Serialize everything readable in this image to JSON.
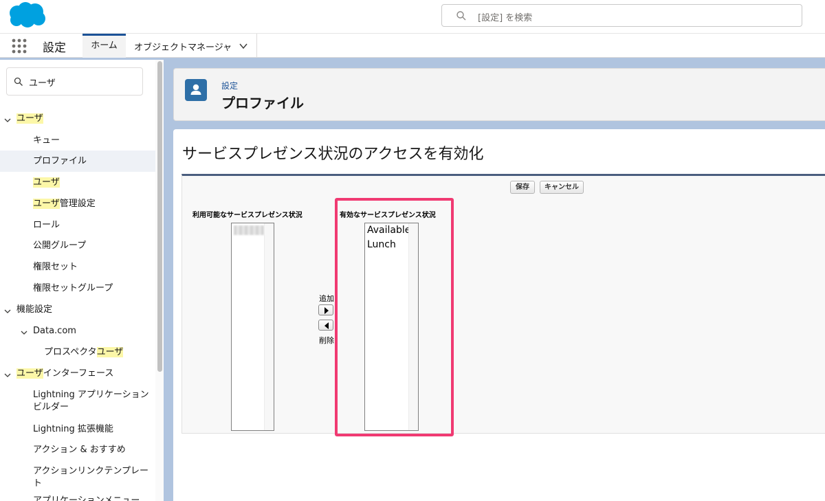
{
  "header": {
    "search_placeholder": "[設定] を検索",
    "brand_color": "#00a1e0"
  },
  "context_bar": {
    "app_name": "設定",
    "tabs": [
      {
        "label": "ホーム",
        "active": true
      },
      {
        "label": "オブジェクトマネージャ",
        "active": false
      }
    ]
  },
  "sidebar": {
    "quickfind_value": "ユーザ",
    "items": [
      {
        "pre": "",
        "hl": "ユーザ",
        "post": "",
        "level": 0,
        "expanded": true
      },
      {
        "pre": "キュー",
        "hl": "",
        "post": "",
        "level": 1
      },
      {
        "pre": "プロファイル",
        "hl": "",
        "post": "",
        "level": 1,
        "selected": true
      },
      {
        "pre": "",
        "hl": "ユーザ",
        "post": "",
        "level": 1
      },
      {
        "pre": "",
        "hl": "ユーザ",
        "post": "管理設定",
        "level": 1
      },
      {
        "pre": "ロール",
        "hl": "",
        "post": "",
        "level": 1
      },
      {
        "pre": "公開グループ",
        "hl": "",
        "post": "",
        "level": 1
      },
      {
        "pre": "権限セット",
        "hl": "",
        "post": "",
        "level": 1
      },
      {
        "pre": "権限セットグループ",
        "hl": "",
        "post": "",
        "level": 1
      },
      {
        "pre": "機能設定",
        "hl": "",
        "post": "",
        "level": 0,
        "expanded": true
      },
      {
        "pre": "Data.com",
        "hl": "",
        "post": "",
        "level": 1,
        "expanded": true
      },
      {
        "pre": "プロスペクタ",
        "hl": "ユーザ",
        "post": "",
        "level": 2
      },
      {
        "pre": "",
        "hl": "ユーザ",
        "post": "インターフェース",
        "level": 0,
        "expanded": true
      },
      {
        "pre": "Lightning アプリケーションビルダー",
        "hl": "",
        "post": "",
        "level": 1
      },
      {
        "pre": "Lightning 拡張機能",
        "hl": "",
        "post": "",
        "level": 1
      },
      {
        "pre": "アクション & おすすめ",
        "hl": "",
        "post": "",
        "level": 1
      },
      {
        "pre": "アクションリンクテンプレート",
        "hl": "",
        "post": "",
        "level": 1
      },
      {
        "pre": "アプリケーションメニュー",
        "hl": "",
        "post": "",
        "level": 1
      }
    ]
  },
  "page_header": {
    "breadcrumb": "設定",
    "title": "プロファイル"
  },
  "content": {
    "title": "サービスプレゼンス状況のアクセスを有効化",
    "save_label": "保存",
    "cancel_label": "キャンセル",
    "available_label": "利用可能なサービスプレゼンス状況",
    "enabled_label": "有効なサービスプレゼンス状況",
    "add_label": "追加",
    "remove_label": "削除",
    "enabled_options": [
      "Available",
      "Lunch"
    ]
  }
}
